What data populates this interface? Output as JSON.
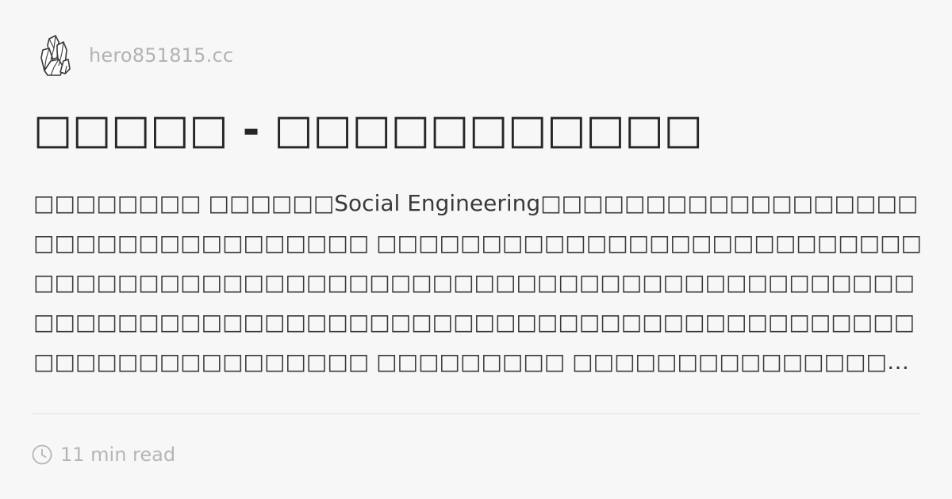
{
  "site": {
    "logo_icon": "crystal-logo-icon",
    "name": "hero851815.cc"
  },
  "article": {
    "title": "□□□□□ - □□□□□□□□□□□",
    "excerpt": "□□□□□□□□ □□□□□□Social Engineering□□□□□□□□□□□□□□□□□□□□□□□□□□□□□□□□□□ □□□□□□□□□□□□□□□□□□□□□□□□□□□□□□□□□□□□□□□□□□□□□□□□□□□□□□□□□□□□□□□□□□□□□□□□□□□□□□□□□□□□□□□□□□□□□□□□□□□□□□□□□□□□□□□□□□□□□□□□□□□□□□ □□□□□□□□□ □□□□□□□□□□□□□□□□□□□□□□□□□□□□□□□□□□□□□□□□□□□□□□□□□□□□□□□□□□",
    "read_time": "11 min read",
    "read_time_icon": "clock-icon"
  },
  "colors": {
    "background": "#f8f7f8",
    "title": "#262626",
    "excerpt": "#3a3a3a",
    "muted": "#b3b3b3",
    "divider": "#e3e2e3"
  }
}
